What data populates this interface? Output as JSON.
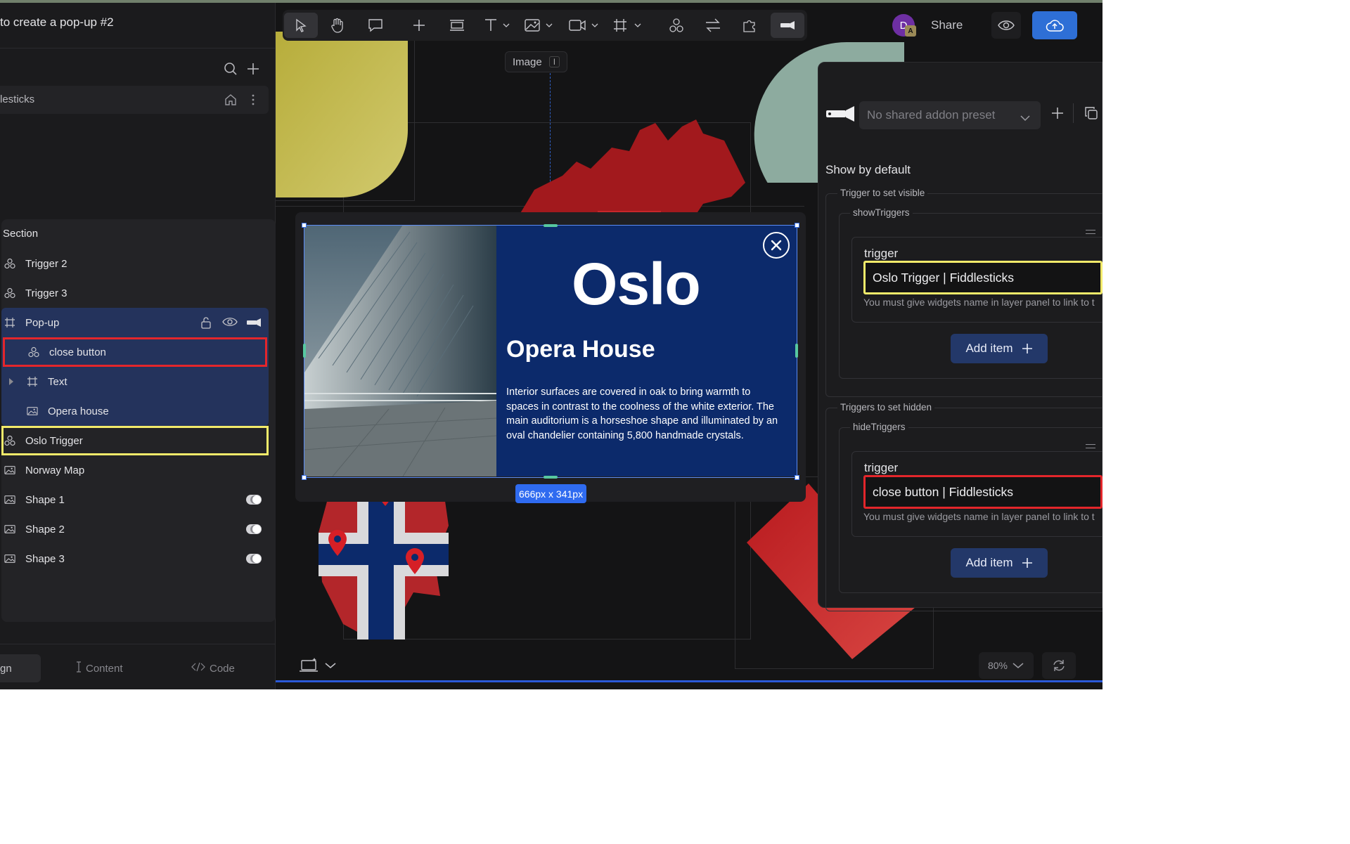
{
  "app": {
    "title": "to create a pop-up #2",
    "project_name": "lesticks"
  },
  "layers": {
    "section_label": "Section",
    "items": [
      {
        "label": "Trigger 2",
        "icon": "component-icon"
      },
      {
        "label": "Trigger 3",
        "icon": "component-icon"
      },
      {
        "label": "Pop-up",
        "icon": "frame-icon"
      },
      {
        "label": "close button",
        "icon": "component-icon"
      },
      {
        "label": "Text",
        "icon": "frame-icon"
      },
      {
        "label": "Opera house",
        "icon": "image-icon"
      },
      {
        "label": "Oslo Trigger",
        "icon": "component-icon"
      },
      {
        "label": "Norway Map",
        "icon": "image-icon"
      },
      {
        "label": "Shape 1",
        "icon": "image-icon"
      },
      {
        "label": "Shape 2",
        "icon": "image-icon"
      },
      {
        "label": "Shape 3",
        "icon": "image-icon"
      }
    ]
  },
  "bottom_tabs": {
    "design": "gn",
    "content": "Content",
    "code": "Code"
  },
  "toolbar": {
    "tooltip_label": "Image",
    "tooltip_shortcut": "I"
  },
  "header": {
    "avatar_initial": "D",
    "avatar_badge": "A",
    "share_label": "Share"
  },
  "popup": {
    "city": "Oslo",
    "subtitle": "Opera House",
    "description": "Interior surfaces are covered in oak to bring warmth to spaces in contrast to the coolness of the white exterior. The main auditorium is a horseshoe shape and illuminated by an oval chandelier containing 5,800 handmade crystals.",
    "size_badge": "666px x 341px"
  },
  "addon_panel": {
    "preset_placeholder": "No shared addon preset",
    "show_by_default": "Show by default",
    "visible_group": {
      "legend": "Trigger to set visible",
      "list_legend": "showTriggers",
      "field_label": "trigger",
      "value": "Oslo Trigger | Fiddlesticks",
      "hint": "You must give widgets name in layer panel to link to t",
      "add_label": "Add item"
    },
    "hidden_group": {
      "legend": "Triggers to set hidden",
      "list_legend": "hideTriggers",
      "field_label": "trigger",
      "value": "close button | Fiddlesticks",
      "hint": "You must give widgets name in layer panel to link to t",
      "add_label": "Add item"
    }
  },
  "footer": {
    "zoom": "80%"
  },
  "colors": {
    "accent_blue": "#2e6fd6",
    "popup_navy": "#0c2a6b",
    "highlight_red": "#e3262b",
    "highlight_yellow": "#f2ea6a"
  }
}
